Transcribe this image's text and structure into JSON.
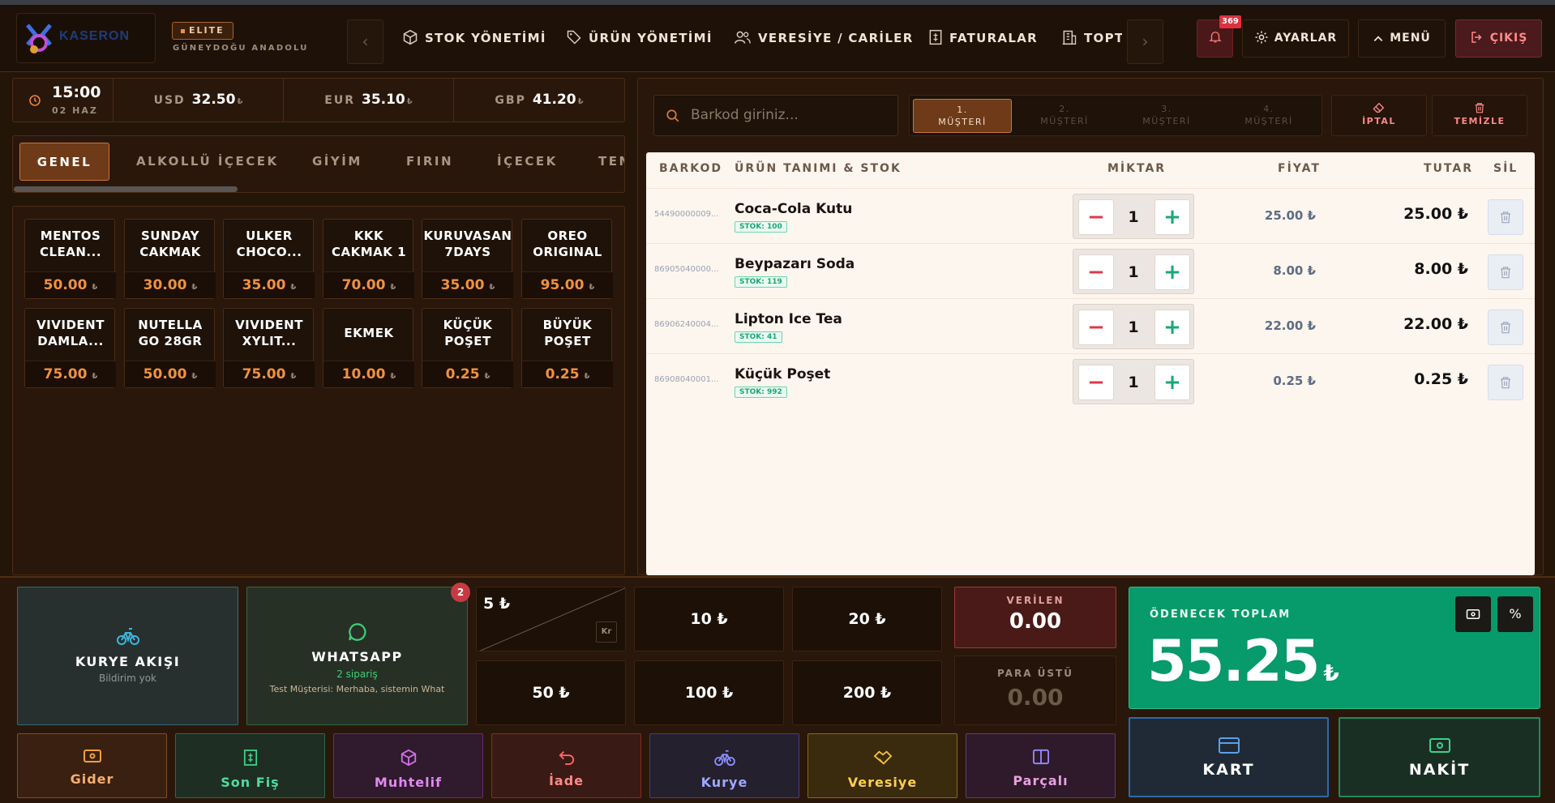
{
  "brand": {
    "logo_text": "KASERON",
    "tier": "ELITE",
    "region": "GÜNEYDOĞU ANADOLU"
  },
  "nav": {
    "prev": "‹",
    "next": "›",
    "items": [
      {
        "label": "STOK YÖNETİMİ",
        "icon": "box-icon"
      },
      {
        "label": "ÜRÜN YÖNETİMİ",
        "icon": "tag-icon"
      },
      {
        "label": "VERESİYE / CARİLER",
        "icon": "users-icon"
      },
      {
        "label": "FATURALAR",
        "icon": "invoice-icon"
      },
      {
        "label": "TOPTAN",
        "icon": "building-icon"
      }
    ]
  },
  "header_actions": {
    "notifications": "369",
    "settings": "AYARLAR",
    "menu": "MENÜ",
    "exit": "ÇIKIŞ"
  },
  "info": {
    "time": "15:00",
    "date": "02 HAZ",
    "currencies": [
      {
        "code": "USD",
        "value": "32.50"
      },
      {
        "code": "EUR",
        "value": "35.10"
      },
      {
        "code": "GBP",
        "value": "41.20"
      }
    ],
    "currency_symbol": "₺"
  },
  "categories": [
    "GENEL",
    "ALKOLLÜ İÇECEK",
    "GİYİM",
    "FIRIN",
    "İÇECEK",
    "TEMİZLİK"
  ],
  "products": [
    {
      "name_line1": "MENTOS",
      "name_line2": "CLEAN...",
      "price": "50.00"
    },
    {
      "name_line1": "SUNDAY",
      "name_line2": "CAKMAK",
      "price": "30.00"
    },
    {
      "name_line1": "ULKER",
      "name_line2": "CHOCO...",
      "price": "35.00"
    },
    {
      "name_line1": "KKK",
      "name_line2": "CAKMAK 1",
      "price": "70.00"
    },
    {
      "name_line1": "KURUVASAN",
      "name_line2": "7DAYS",
      "price": "35.00"
    },
    {
      "name_line1": "OREO",
      "name_line2": "ORIGINAL",
      "price": "95.00"
    },
    {
      "name_line1": "VIVIDENT",
      "name_line2": "DAMLA...",
      "price": "75.00"
    },
    {
      "name_line1": "NUTELLA",
      "name_line2": "GO 28GR",
      "price": "50.00"
    },
    {
      "name_line1": "VIVIDENT",
      "name_line2": "XYLIT...",
      "price": "75.00"
    },
    {
      "name_line1": "EKMEK",
      "name_line2": "",
      "price": "10.00"
    },
    {
      "name_line1": "KÜÇÜK",
      "name_line2": "POŞET",
      "price": "0.25"
    },
    {
      "name_line1": "BÜYÜK",
      "name_line2": "POŞET",
      "price": "0.25"
    }
  ],
  "search": {
    "placeholder": "Barkod giriniz..."
  },
  "customers": [
    {
      "num": "1.",
      "label": "MÜŞTERİ"
    },
    {
      "num": "2.",
      "label": "MÜŞTERİ"
    },
    {
      "num": "3.",
      "label": "MÜŞTERİ"
    },
    {
      "num": "4.",
      "label": "MÜŞTERİ"
    }
  ],
  "cart_actions": {
    "cancel": "İPTAL",
    "clear": "TEMİZLE"
  },
  "table": {
    "headers": {
      "barcode": "BARKOD",
      "product": "ÜRÜN TANIMI & STOK",
      "qty": "MİKTAR",
      "price": "FİYAT",
      "total": "TUTAR",
      "delete": "SİL"
    },
    "rows": [
      {
        "barcode": "54490000009...",
        "name": "Coca-Cola Kutu",
        "stock": "STOK: 100",
        "qty": "1",
        "price": "25.00 ₺",
        "total": "25.00 ₺"
      },
      {
        "barcode": "86905040000...",
        "name": "Beypazarı Soda",
        "stock": "STOK: 119",
        "qty": "1",
        "price": "8.00 ₺",
        "total": "8.00 ₺"
      },
      {
        "barcode": "86906240004...",
        "name": "Lipton Ice Tea",
        "stock": "STOK: 41",
        "qty": "1",
        "price": "22.00 ₺",
        "total": "22.00 ₺"
      },
      {
        "barcode": "86908040001...",
        "name": "Küçük Poşet",
        "stock": "STOK: 992",
        "qty": "1",
        "price": "0.25 ₺",
        "total": "0.25 ₺"
      }
    ]
  },
  "courier": {
    "title": "KURYE AKIŞI",
    "subtitle": "Bildirim yok"
  },
  "whatsapp": {
    "title": "WHATSAPP",
    "orders": "2 sipariş",
    "preview": "Test Müşterisi: Merhaba, sistemin What",
    "badge": "2"
  },
  "quick_amounts": [
    "5 ₺",
    "10 ₺",
    "20 ₺",
    "50 ₺",
    "100 ₺",
    "200 ₺"
  ],
  "coin_label": "Kr",
  "given": {
    "label": "VERİLEN",
    "value": "0.00"
  },
  "change": {
    "label": "PARA ÜSTÜ",
    "value": "0.00"
  },
  "total": {
    "label": "ÖDENECEK TOPLAM",
    "value": "55.25",
    "symbol": "₺"
  },
  "pay": {
    "card": "KART",
    "cash": "NAKİT"
  },
  "actions": [
    {
      "label": "Gider",
      "icon": "cash-icon"
    },
    {
      "label": "Son Fiş",
      "icon": "receipt-icon"
    },
    {
      "label": "Muhtelif",
      "icon": "package-icon"
    },
    {
      "label": "İade",
      "icon": "undo-icon"
    },
    {
      "label": "Kurye",
      "icon": "bike-icon"
    },
    {
      "label": "Veresiye",
      "icon": "handshake-icon"
    },
    {
      "label": "Parçalı",
      "icon": "split-icon"
    }
  ]
}
